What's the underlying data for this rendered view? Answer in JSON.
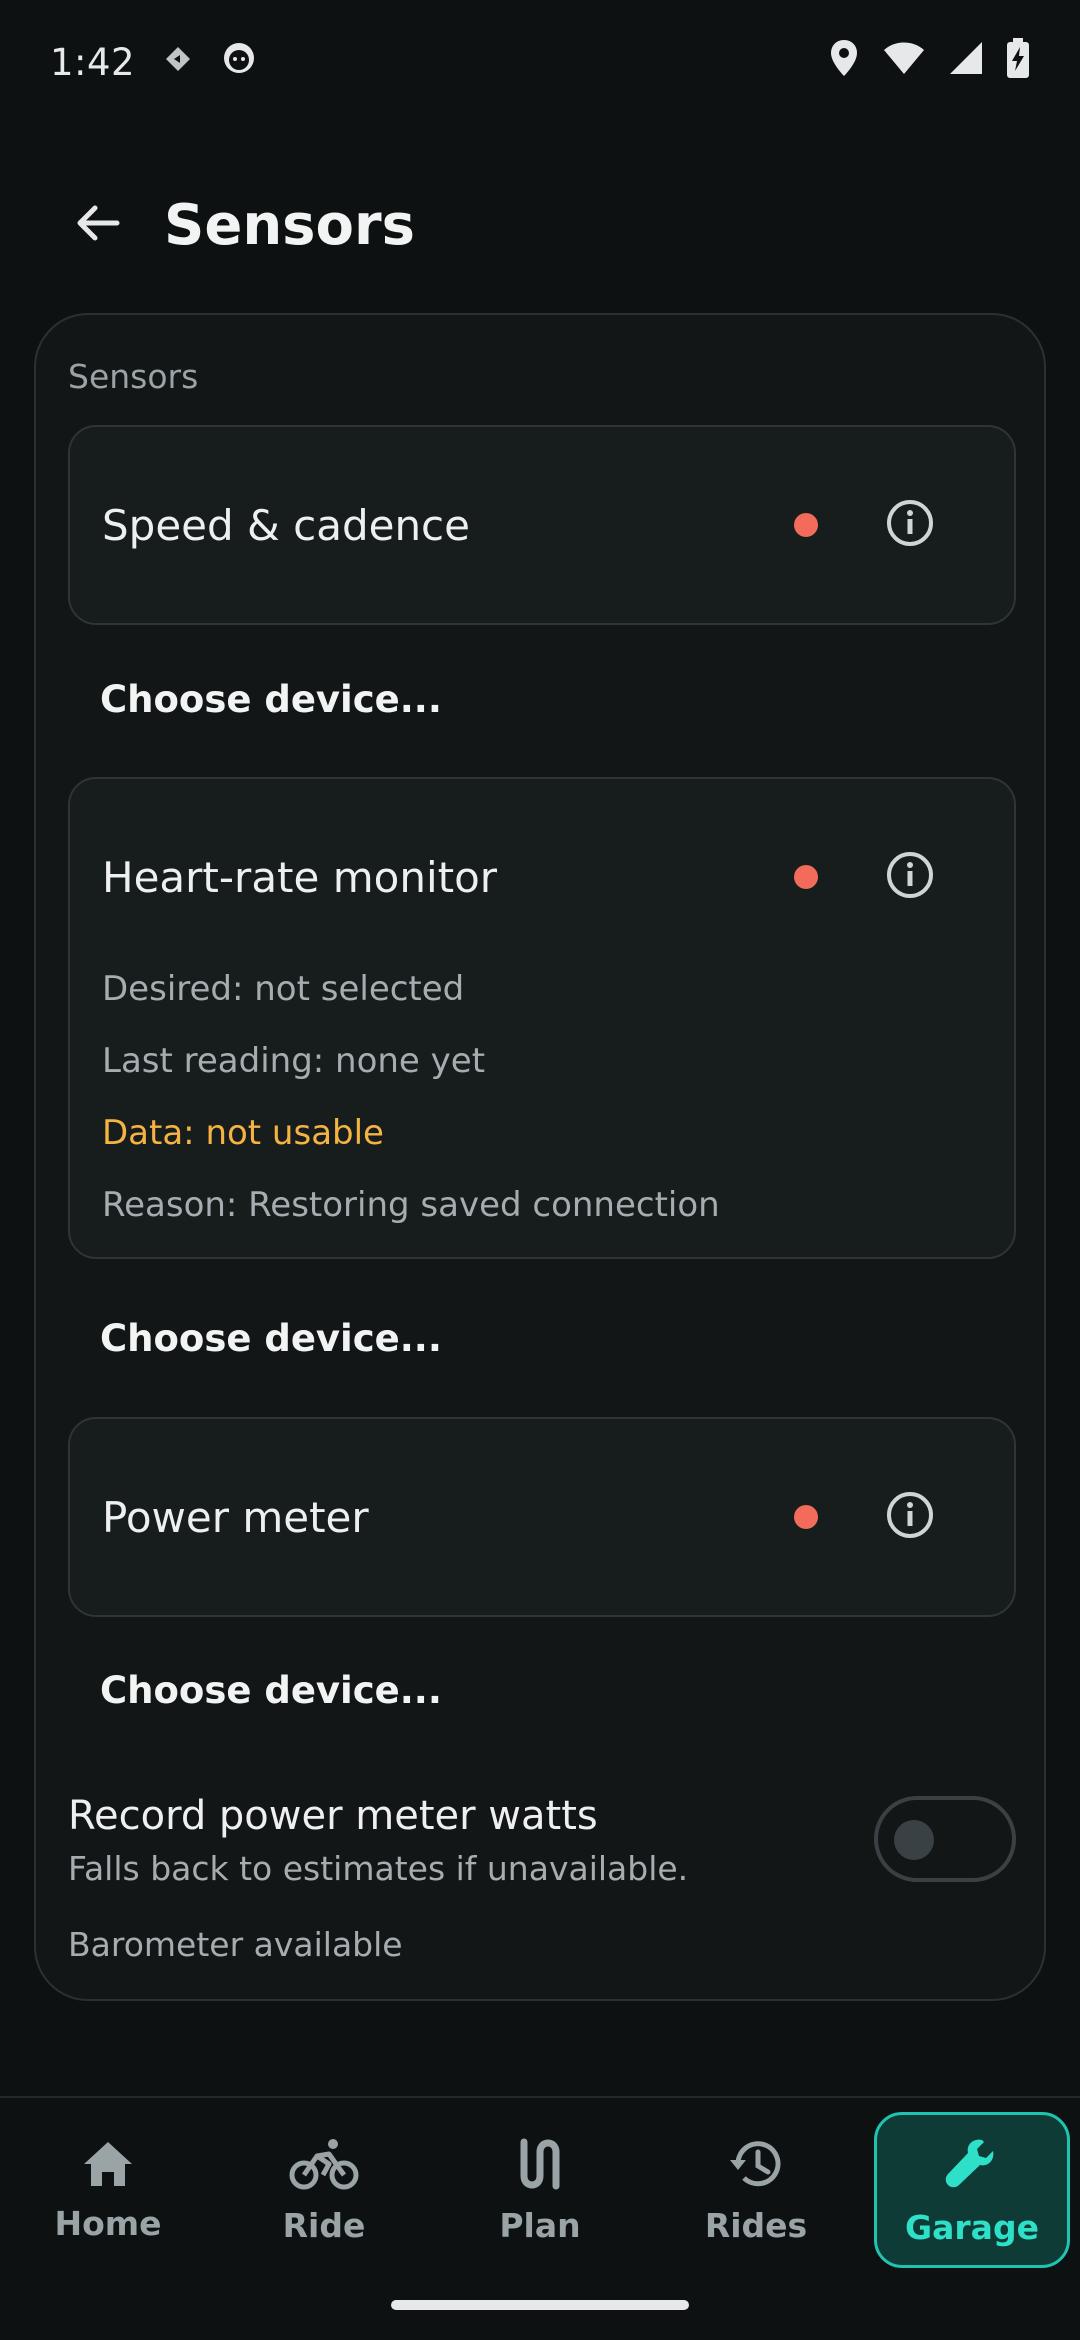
{
  "status_bar": {
    "time": "1:42",
    "icons": [
      "diamond-notification-icon",
      "cat-notification-icon",
      "location-icon",
      "wifi-icon",
      "cellular-signal-icon",
      "battery-charging-icon"
    ]
  },
  "header": {
    "title": "Sensors",
    "back_icon": "arrow-left-icon"
  },
  "panel": {
    "section_label": "Sensors",
    "sensors": [
      {
        "name": "Speed & cadence",
        "status_color": "#f26b5b",
        "choose_label": "Choose device..."
      },
      {
        "name": "Heart-rate monitor",
        "status_color": "#f26b5b",
        "details": {
          "desired": "Desired: not selected",
          "last_reading": "Last reading: none yet",
          "data": "Data: not usable",
          "reason": "Reason: Restoring saved connection"
        },
        "choose_label": "Choose device..."
      },
      {
        "name": "Power meter",
        "status_color": "#f26b5b",
        "choose_label": "Choose device..."
      }
    ],
    "record_power": {
      "title": "Record power meter watts",
      "subtitle": "Falls back to estimates if unavailable.",
      "enabled": false
    },
    "barometer": "Barometer available"
  },
  "bottom_nav": {
    "items": [
      {
        "label": "Home",
        "icon": "home-icon"
      },
      {
        "label": "Ride",
        "icon": "bicycle-icon"
      },
      {
        "label": "Plan",
        "icon": "route-icon"
      },
      {
        "label": "Rides",
        "icon": "history-icon"
      },
      {
        "label": "Garage",
        "icon": "wrench-icon",
        "active": true
      }
    ]
  },
  "colors": {
    "accent": "#2ee0c8",
    "warning": "#f5b342",
    "status_error": "#f26b5b"
  }
}
